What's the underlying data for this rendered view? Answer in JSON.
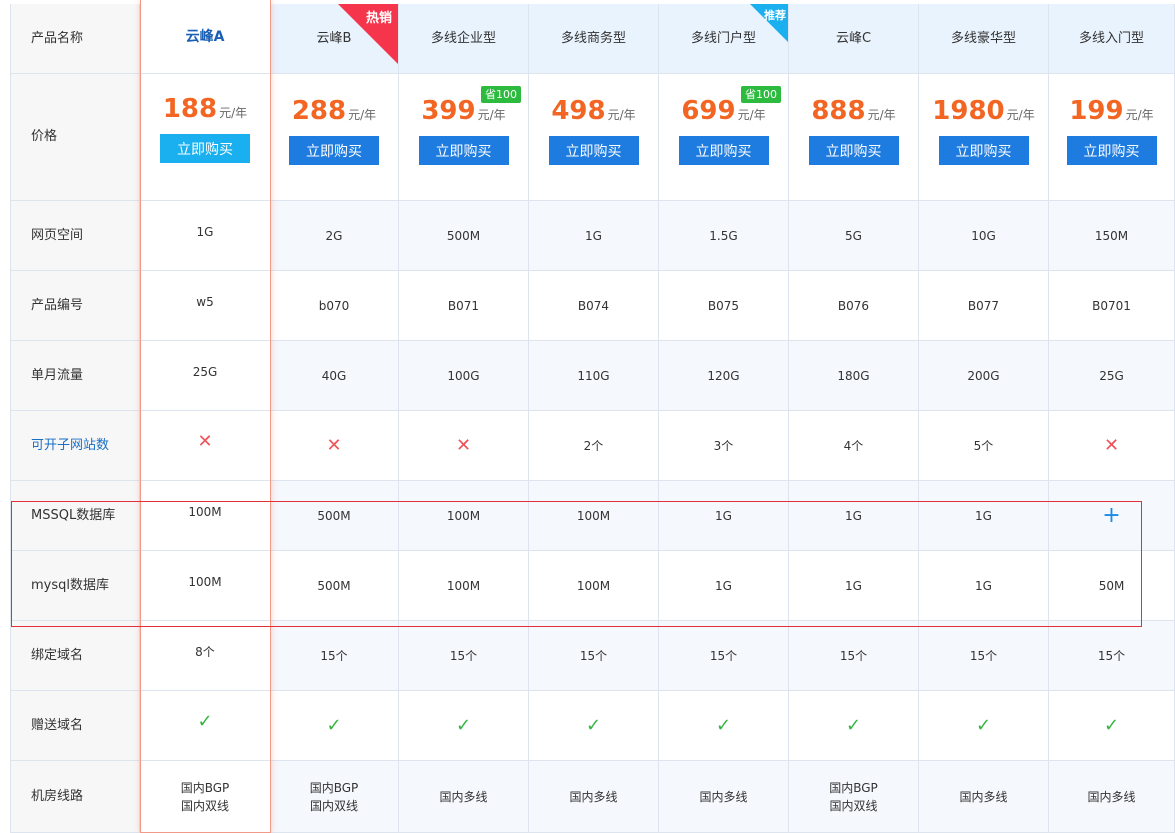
{
  "table": {
    "row_labels": {
      "name": "产品名称",
      "price": "价格",
      "space": "网页空间",
      "code": "产品编号",
      "traffic": "单月流量",
      "subsites": "可开子网站数",
      "mssql": "MSSQL数据库",
      "mysql": "mysql数据库",
      "domains": "绑定域名",
      "gift_domain": "赠送域名",
      "line": "机房线路"
    },
    "price_unit": "元/年",
    "buy_label": "立即购买",
    "products": [
      {
        "name": "云峰A",
        "price": "188",
        "space": "1G",
        "code": "w5",
        "traffic": "25G",
        "subsites": "x-icon",
        "mssql": "100M",
        "mysql": "100M",
        "domains": "8个",
        "gift_domain": "check-icon",
        "line": [
          "国内BGP",
          "国内双线"
        ]
      },
      {
        "name": "云峰B",
        "ribbon": "热销",
        "price": "288",
        "space": "2G",
        "code": "b070",
        "traffic": "40G",
        "subsites": "x-icon",
        "mssql": "500M",
        "mysql": "500M",
        "domains": "15个",
        "gift_domain": "check-icon",
        "line": [
          "国内BGP",
          "国内双线"
        ]
      },
      {
        "name": "多线企业型",
        "badge": "省100",
        "price": "399",
        "space": "500M",
        "code": "B071",
        "traffic": "100G",
        "subsites": "x-icon",
        "mssql": "100M",
        "mysql": "100M",
        "domains": "15个",
        "gift_domain": "check-icon",
        "line": [
          "国内多线"
        ]
      },
      {
        "name": "多线商务型",
        "price": "498",
        "space": "1G",
        "code": "B074",
        "traffic": "110G",
        "subsites": "2个",
        "mssql": "100M",
        "mysql": "100M",
        "domains": "15个",
        "gift_domain": "check-icon",
        "line": [
          "国内多线"
        ]
      },
      {
        "name": "多线门户型",
        "ribbon": "推荐",
        "badge": "省100",
        "price": "699",
        "space": "1.5G",
        "code": "B075",
        "traffic": "120G",
        "subsites": "3个",
        "mssql": "1G",
        "mysql": "1G",
        "domains": "15个",
        "gift_domain": "check-icon",
        "line": [
          "国内多线"
        ]
      },
      {
        "name": "云峰C",
        "price": "888",
        "space": "5G",
        "code": "B076",
        "traffic": "180G",
        "subsites": "4个",
        "mssql": "1G",
        "mysql": "1G",
        "domains": "15个",
        "gift_domain": "check-icon",
        "line": [
          "国内BGP",
          "国内双线"
        ]
      },
      {
        "name": "多线豪华型",
        "price": "1980",
        "space": "10G",
        "code": "B077",
        "traffic": "200G",
        "subsites": "5个",
        "mssql": "1G",
        "mysql": "1G",
        "domains": "15个",
        "gift_domain": "check-icon",
        "line": [
          "国内多线"
        ]
      },
      {
        "name": "多线入门型",
        "price": "199",
        "space": "150M",
        "code": "B0701",
        "traffic": "25G",
        "subsites": "x-icon",
        "mssql": "plus-icon",
        "mysql": "50M",
        "domains": "15个",
        "gift_domain": "check-icon",
        "line": [
          "国内多线"
        ]
      }
    ]
  },
  "colors": {
    "price": "#f26522",
    "buy_button": "#1e7ce0",
    "featured_buy_button": "#1ab0ef",
    "hot_ribbon": "#f5354b",
    "recommend_ribbon": "#1ab0ef",
    "save_badge": "#2cbb3f",
    "selection_box": "#e0303a"
  }
}
